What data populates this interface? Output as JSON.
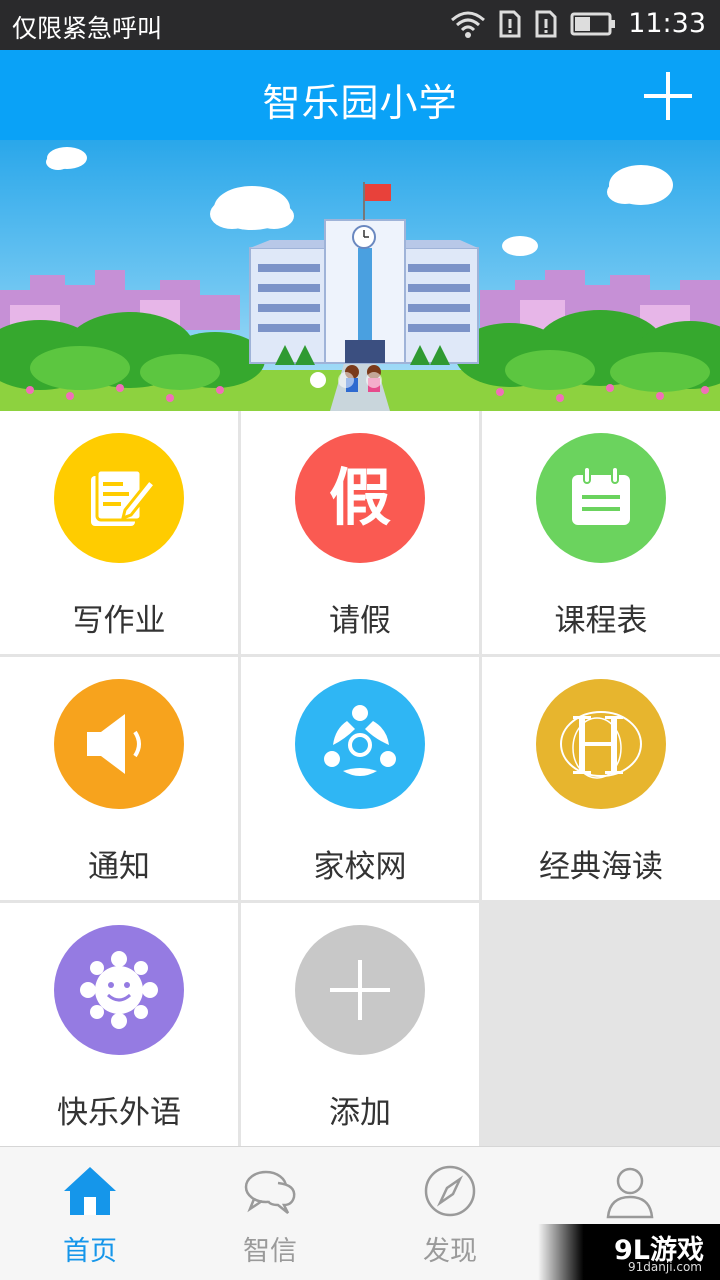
{
  "status_bar": {
    "carrier": "仅限紧急呼叫",
    "time": "11:33"
  },
  "header": {
    "title": "智乐园小学",
    "add_icon": "plus-icon"
  },
  "banner": {
    "dots": 3,
    "active_dot": 0
  },
  "grid": {
    "items": [
      {
        "label": "写作业",
        "icon": "homework-icon",
        "color": "#ffcc00"
      },
      {
        "label": "请假",
        "icon": "leave-icon",
        "glyph": "假",
        "color": "#fa5a52"
      },
      {
        "label": "课程表",
        "icon": "calendar-icon",
        "color": "#6bd35e"
      },
      {
        "label": "通知",
        "icon": "speaker-icon",
        "color": "#f7a31d"
      },
      {
        "label": "家校网",
        "icon": "network-icon",
        "color": "#2fb6f4"
      },
      {
        "label": "经典海读",
        "icon": "classic-reading-icon",
        "color": "#e7b52e"
      },
      {
        "label": "快乐外语",
        "icon": "sun-face-icon",
        "color": "#957be2"
      },
      {
        "label": "添加",
        "icon": "plus-icon",
        "color": "#c8c8c8"
      }
    ]
  },
  "tabs": [
    {
      "label": "首页",
      "icon": "home-icon",
      "active": true
    },
    {
      "label": "智信",
      "icon": "chat-icon",
      "active": false
    },
    {
      "label": "发现",
      "icon": "compass-icon",
      "active": false
    },
    {
      "label": "",
      "icon": "profile-icon",
      "active": false
    }
  ],
  "watermark": {
    "main": "9L游戏",
    "sub": "91danji.com"
  },
  "colors": {
    "header": "#0aa2f7",
    "active_tab": "#1596ea",
    "inactive_tab": "#9a9a9a"
  }
}
